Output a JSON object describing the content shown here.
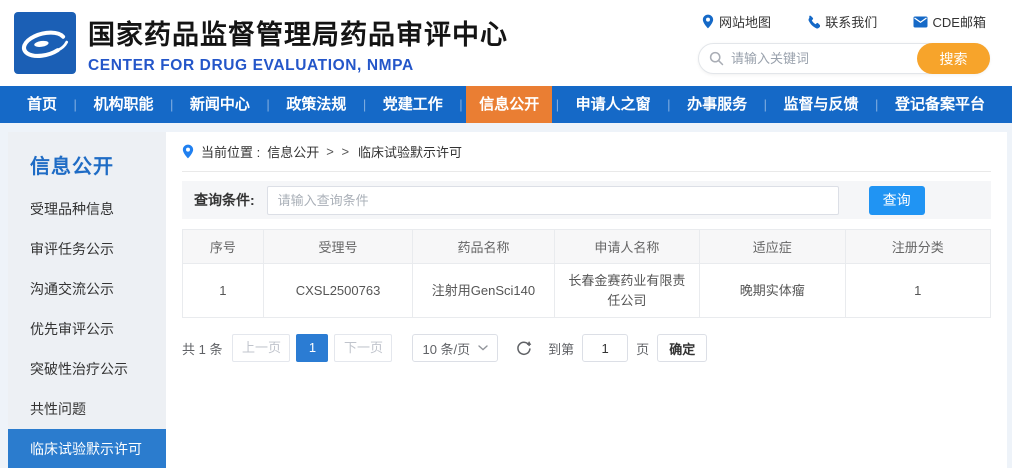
{
  "header": {
    "title": "国家药品监督管理局药品审评中心",
    "subtitle": "CENTER FOR DRUG EVALUATION, NMPA",
    "links": [
      {
        "icon": "location-pin-icon",
        "label": "网站地图"
      },
      {
        "icon": "phone-icon",
        "label": "联系我们"
      },
      {
        "icon": "envelope-icon",
        "label": "CDE邮箱"
      }
    ],
    "search": {
      "placeholder": "请输入关键词",
      "button_label": "搜索"
    }
  },
  "nav": {
    "separator": "|",
    "items": [
      {
        "label": "首页",
        "active": false
      },
      {
        "label": "机构职能",
        "active": false
      },
      {
        "label": "新闻中心",
        "active": false
      },
      {
        "label": "政策法规",
        "active": false
      },
      {
        "label": "党建工作",
        "active": false
      },
      {
        "label": "信息公开",
        "active": true
      },
      {
        "label": "申请人之窗",
        "active": false
      },
      {
        "label": "办事服务",
        "active": false
      },
      {
        "label": "监督与反馈",
        "active": false
      },
      {
        "label": "登记备案平台",
        "active": false
      }
    ]
  },
  "sidebar": {
    "title": "信息公开",
    "items": [
      {
        "label": "受理品种信息",
        "active": false
      },
      {
        "label": "审评任务公示",
        "active": false
      },
      {
        "label": "沟通交流公示",
        "active": false
      },
      {
        "label": "优先审评公示",
        "active": false
      },
      {
        "label": "突破性治疗公示",
        "active": false
      },
      {
        "label": "共性问题",
        "active": false
      },
      {
        "label": "临床试验默示许可",
        "active": true
      }
    ]
  },
  "breadcrumb": {
    "label": "当前位置 : ",
    "parent": "信息公开",
    "separator": "> >",
    "current": "临床试验默示许可"
  },
  "query": {
    "label": "查询条件:",
    "placeholder": "请输入查询条件",
    "button_label": "查询"
  },
  "table": {
    "headers": [
      "序号",
      "受理号",
      "药品名称",
      "申请人名称",
      "适应症",
      "注册分类"
    ],
    "rows": [
      [
        "1",
        "CXSL2500763",
        "注射用GenSci140",
        "长春金赛药业有限责任公司",
        "晚期实体瘤",
        "1"
      ]
    ]
  },
  "pagination": {
    "total": "共 1 条",
    "prev": "上一页",
    "page": "1",
    "next": "下一页",
    "page_size": "10 条/页",
    "goto_label": "到第",
    "goto_value": "1",
    "goto_unit": "页",
    "confirm": "确定"
  },
  "colors": {
    "nav_blue": "#1569c7",
    "nav_active_orange": "#ea7e33",
    "search_button_orange": "#f7a42b",
    "sidebar_active_blue": "#2b7cce",
    "query_button_blue": "#2094f3",
    "subtitle_blue": "#2456c9",
    "logo_blue": "#1b5fb5"
  }
}
